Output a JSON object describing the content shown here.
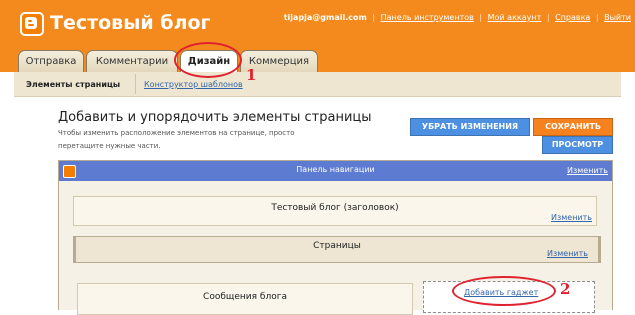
{
  "header": {
    "blog_title": "Тестовый блог",
    "user_email": "tijapja@gmail.com",
    "links": [
      "Панель инструментов",
      "Мой аккаунт",
      "Справка",
      "Выйти"
    ]
  },
  "tabs": {
    "posting": "Отправка",
    "comments": "Комментарии",
    "design": "Дизайн",
    "monetize": "Коммерция"
  },
  "subnav": {
    "page_elements": "Элементы страницы",
    "template_designer": "Конструктор шаблонов"
  },
  "page": {
    "heading": "Добавить и упорядочить элементы страницы",
    "description": "Чтобы изменить расположение элементов на странице, просто перетащите нужные части."
  },
  "buttons": {
    "revert": "УБРАТЬ ИЗМЕНЕНИЯ",
    "save": "СОХРАНИТЬ",
    "preview": "ПРОСМОТР"
  },
  "layout": {
    "navbar_title": "Панель навигации",
    "edit_label": "Изменить",
    "header_widget_title": "Тестовый блог (заголовок)",
    "pages_widget_title": "Страницы",
    "posts_widget_title": "Сообщения блога",
    "add_gadget": "Добавить гаджет"
  },
  "annotations": {
    "marker_1": "1",
    "marker_2": "2",
    "color": "#e0222e"
  },
  "colors": {
    "brand_orange": "#f48a1d",
    "button_blue": "#4d8fe0",
    "button_orange": "#f5821f",
    "navbar_blue": "#5d7bd0",
    "link_blue": "#3366aa"
  }
}
